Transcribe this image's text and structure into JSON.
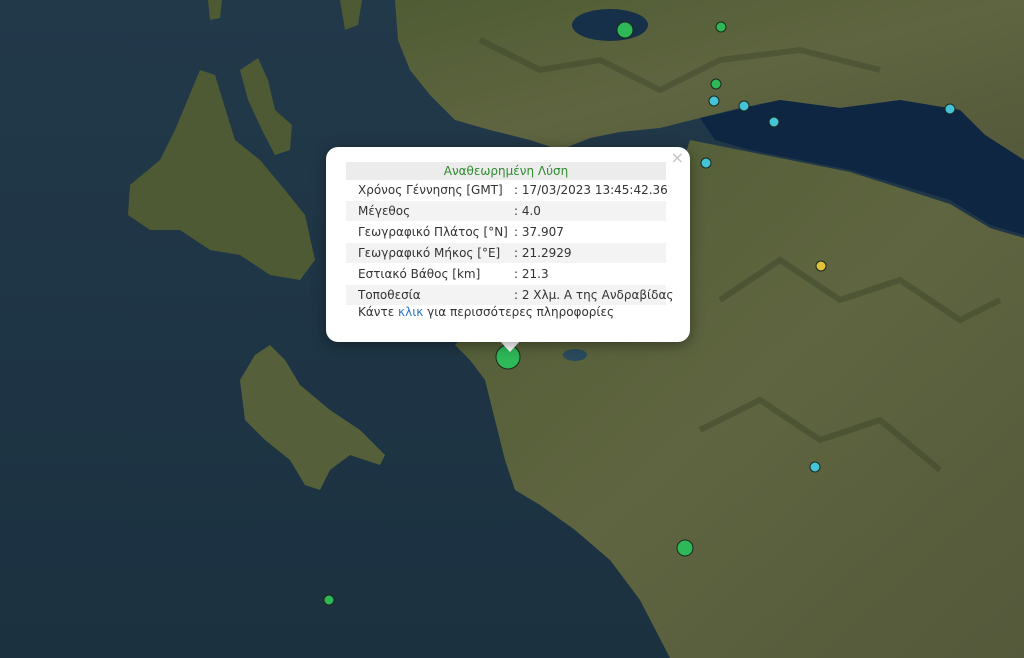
{
  "map": {
    "colors": {
      "sea": "#1e3544",
      "land": "#55603a",
      "gulf": "#0d2440"
    },
    "markers": [
      {
        "kind": "old",
        "color": "#2eb857",
        "size": "medium"
      },
      {
        "kind": "old",
        "color": "#2eb857",
        "size": "small"
      },
      {
        "kind": "old",
        "color": "#2eb857",
        "size": "small"
      },
      {
        "kind": "recent",
        "color": "#45c4d8",
        "size": "small"
      },
      {
        "kind": "recent",
        "color": "#45c4d8",
        "size": "small"
      },
      {
        "kind": "recent",
        "color": "#45c4d8",
        "size": "small"
      },
      {
        "kind": "recent",
        "color": "#45c4d8",
        "size": "small"
      },
      {
        "kind": "recent",
        "color": "#45c4d8",
        "size": "small"
      },
      {
        "kind": "week",
        "color": "#e0c33a",
        "size": "small"
      },
      {
        "kind": "recent",
        "color": "#45c4d8",
        "size": "small"
      },
      {
        "kind": "old",
        "color": "#2eb857",
        "size": "medium"
      },
      {
        "kind": "old",
        "color": "#2eb857",
        "size": "small"
      },
      {
        "kind": "selected",
        "color": "#2eb857",
        "size": "large"
      }
    ]
  },
  "popup": {
    "title": "Αναθεωρημένη Λύση",
    "close_icon": "×",
    "rows": [
      {
        "label": "Χρόνος Γέννησης [GMT]",
        "value": ": 17/03/2023 13:45:42.36"
      },
      {
        "label": "Μέγεθος",
        "value": ": 4.0"
      },
      {
        "label": "Γεωγραφικό Πλάτος [°N]",
        "value": ": 37.907"
      },
      {
        "label": "Γεωγραφικό Μήκος [°E]",
        "value": ": 21.2929"
      },
      {
        "label": "Εστιακό Βάθος [km]",
        "value": ": 21.3"
      },
      {
        "label": "Τοποθεσία",
        "value": ": 2 Χλμ. Α της Ανδραβίδας"
      }
    ],
    "footer_pre": "Κάντε ",
    "footer_link": "κλικ",
    "footer_post": " για περισσότερες πληροφορίες"
  }
}
